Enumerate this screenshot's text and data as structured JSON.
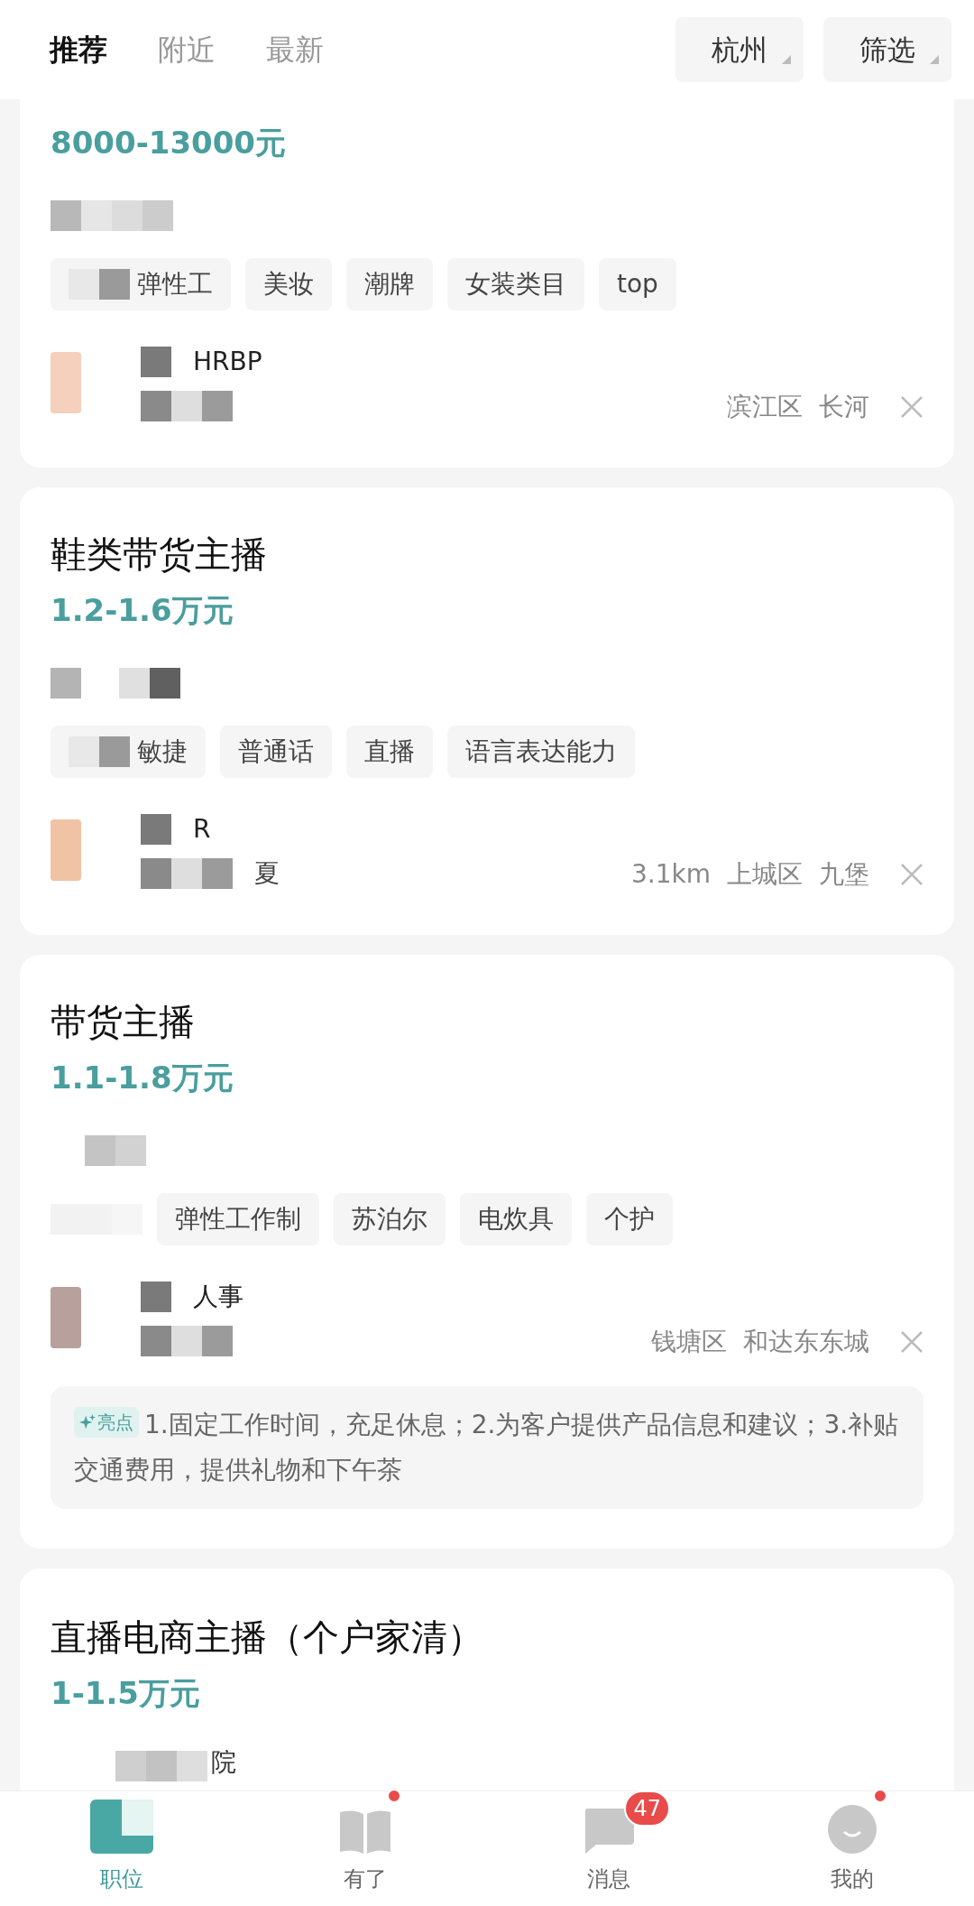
{
  "header": {
    "tabs": [
      {
        "label": "推荐",
        "selected": true
      },
      {
        "label": "附近",
        "selected": false
      },
      {
        "label": "最新",
        "selected": false
      }
    ],
    "city": "杭州",
    "filter": "筛选"
  },
  "jobs": [
    {
      "salary": "8000-13000元",
      "tags": [
        {
          "label": "弹性工",
          "kind": "covered"
        },
        {
          "label": "美妆",
          "kind": "plain"
        },
        {
          "label": "潮牌",
          "kind": "plain"
        },
        {
          "label": "女装类目",
          "kind": "plain"
        },
        {
          "label": "top",
          "kind": "plain"
        }
      ],
      "recruiter": {
        "name": "HRBP"
      },
      "location": [
        "滨江区",
        "长河"
      ]
    },
    {
      "title": "鞋类带货主播",
      "salary": "1.2-1.6万元",
      "tags": [
        {
          "label": "敏捷",
          "kind": "covered"
        },
        {
          "label": "普通话",
          "kind": "plain"
        },
        {
          "label": "直播",
          "kind": "plain"
        },
        {
          "label": "语言表达能力",
          "kind": "plain"
        }
      ],
      "recruiter": {
        "name": "R",
        "company": "夏"
      },
      "location": [
        "3.1km",
        "上城区",
        "九堡"
      ]
    },
    {
      "title": "带货主播",
      "salary": "1.1-1.8万元",
      "tags": [
        {
          "label": "弹性工作制",
          "kind": "plain"
        },
        {
          "label": "苏泊尔",
          "kind": "plain"
        },
        {
          "label": "电炊具",
          "kind": "plain"
        },
        {
          "label": "个护",
          "kind": "plain"
        }
      ],
      "recruiter": {
        "name": "人事"
      },
      "location": [
        "钱塘区",
        "和达东东城"
      ],
      "highlight": {
        "badge": "亮点",
        "text": "1.固定工作时间，充足休息；2.为客户提供产品信息和建议；3.补贴交通费用，提供礼物和下午茶"
      }
    },
    {
      "title": "直播电商主播（个户家清）",
      "salary": "1-1.5万元",
      "company_fragment": "院"
    }
  ],
  "nav": [
    {
      "label": "职位",
      "selected": true
    },
    {
      "label": "有了",
      "selected": false,
      "dot": true
    },
    {
      "label": "消息",
      "selected": false,
      "badge": "47"
    },
    {
      "label": "我的",
      "selected": false,
      "dot": true
    }
  ]
}
